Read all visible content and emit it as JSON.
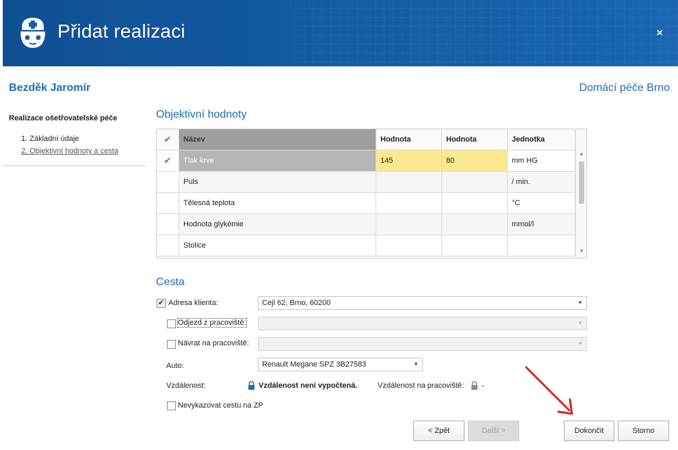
{
  "header": {
    "title": "Přidat realizaci",
    "close": "×"
  },
  "patient": {
    "name": "Bezděk Jaromír",
    "organization": "Domácí péče Brno"
  },
  "nav": {
    "title": "Realizace ošetřovatelské péče",
    "steps": [
      "1. Základní údaje",
      "2. Objektivní hodnoty a cesta"
    ]
  },
  "objective": {
    "section_title": "Objektivní hodnoty",
    "columns": [
      "Název",
      "Hodnota",
      "Hodnota",
      "Jednotka"
    ],
    "header_check": "✔",
    "rows": [
      {
        "check": "✔",
        "name": "Tlak krve",
        "v1": "145",
        "v2": "80",
        "unit": "mm HG"
      },
      {
        "check": "",
        "name": "Puls",
        "v1": "",
        "v2": "",
        "unit": "/ min."
      },
      {
        "check": "",
        "name": "Tělesná teplota",
        "v1": "",
        "v2": "",
        "unit": "°C"
      },
      {
        "check": "",
        "name": "Hodnota glykémie",
        "v1": "",
        "v2": "",
        "unit": "mmol/l"
      },
      {
        "check": "",
        "name": "Stolice",
        "v1": "",
        "v2": "",
        "unit": ""
      }
    ]
  },
  "cesta": {
    "section_title": "Cesta",
    "adresa_label": "Adresa klienta:",
    "adresa_checked": "✔",
    "adresa_value": "Cejl 62, Brno, 60200",
    "odjezd_label": "Odjezd z pracoviště:",
    "navrat_label": "Návrat na pracoviště:",
    "auto_label": "Auto:",
    "auto_value": "Renault Megane SPZ 3B27583",
    "vzdalenost_label": "Vzdálenost:",
    "vzdalenost_value": "Vzdálenost není vypočtená.",
    "vzdalenost_prac_label": "Vzdálenost na pracoviště:",
    "vzdalenost_prac_value": "-",
    "nevykazovat_label": "Nevykazovat cestu na ZP"
  },
  "buttons": {
    "back": "< Zpět",
    "next": "Další >",
    "finish": "Dokončit",
    "cancel": "Storno"
  },
  "colors": {
    "header_bg": "#145da6",
    "accent_text": "#1c6fb5",
    "selected_value": "#fbe98f",
    "arrow": "#d42525"
  }
}
